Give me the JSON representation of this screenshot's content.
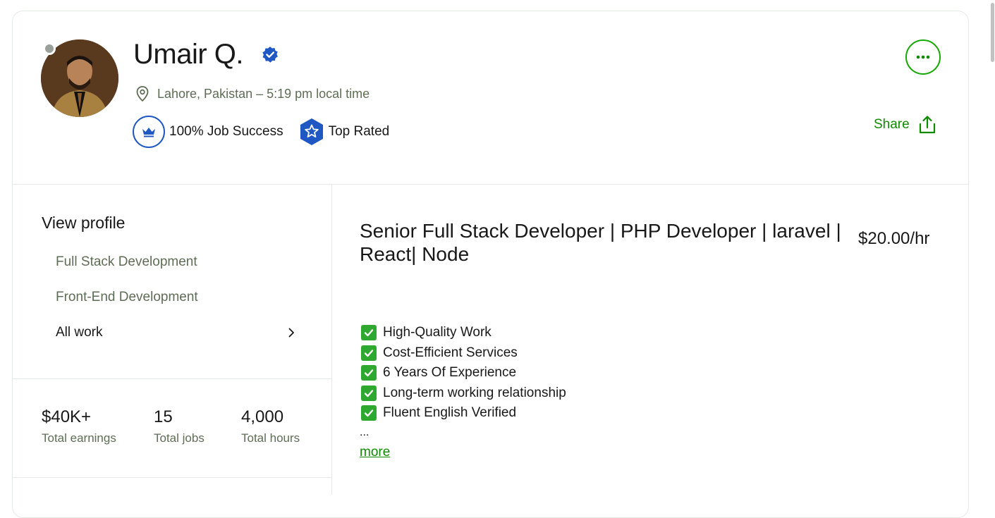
{
  "profile": {
    "name": "Umair Q.",
    "location": "Lahore, Pakistan – 5:19 pm local time",
    "job_success": "100% Job Success",
    "top_rated": "Top Rated",
    "share_label": "Share",
    "avatar_icon": "profile-photo",
    "status": "offline"
  },
  "sidebar": {
    "view_profile": "View profile",
    "items": [
      {
        "label": "Full Stack Development"
      },
      {
        "label": "Front-End Development"
      },
      {
        "label": "All work"
      }
    ]
  },
  "stats": [
    {
      "value": "$40K+",
      "label": "Total earnings"
    },
    {
      "value": "15",
      "label": "Total jobs"
    },
    {
      "value": "4,000",
      "label": "Total hours"
    }
  ],
  "main": {
    "title": "Senior Full Stack Developer | PHP Developer | laravel | React| Node",
    "rate": "$20.00/hr",
    "features": [
      "High-Quality Work",
      "Cost-Efficient Services",
      "6 Years Of Experience",
      "Long-term working relationship",
      "Fluent English Verified"
    ],
    "ellipsis": "...",
    "more_label": "more"
  },
  "colors": {
    "accent_green": "#14a800",
    "link_green": "#108a00",
    "badge_blue": "#1f57c3",
    "check_green": "#2ea82e",
    "muted_text": "#5e6d55"
  }
}
